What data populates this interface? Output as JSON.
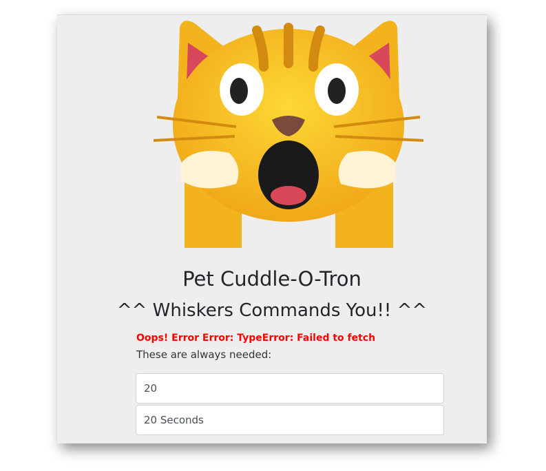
{
  "app": {
    "title": "Pet Cuddle-O-Tron",
    "subtitle": "^^ Whiskers Commands You!! ^^"
  },
  "image": {
    "icon": "cat-weary-emoji-icon"
  },
  "status": {
    "error": "Oops! Error Error: TypeError: Failed to fetch",
    "note": "These are always needed:"
  },
  "form": {
    "field1_value": "20",
    "field2_value": "20 Seconds"
  },
  "colors": {
    "error": "#ff0000",
    "panel": "#eeeeee",
    "cat": "#f5b51c"
  }
}
